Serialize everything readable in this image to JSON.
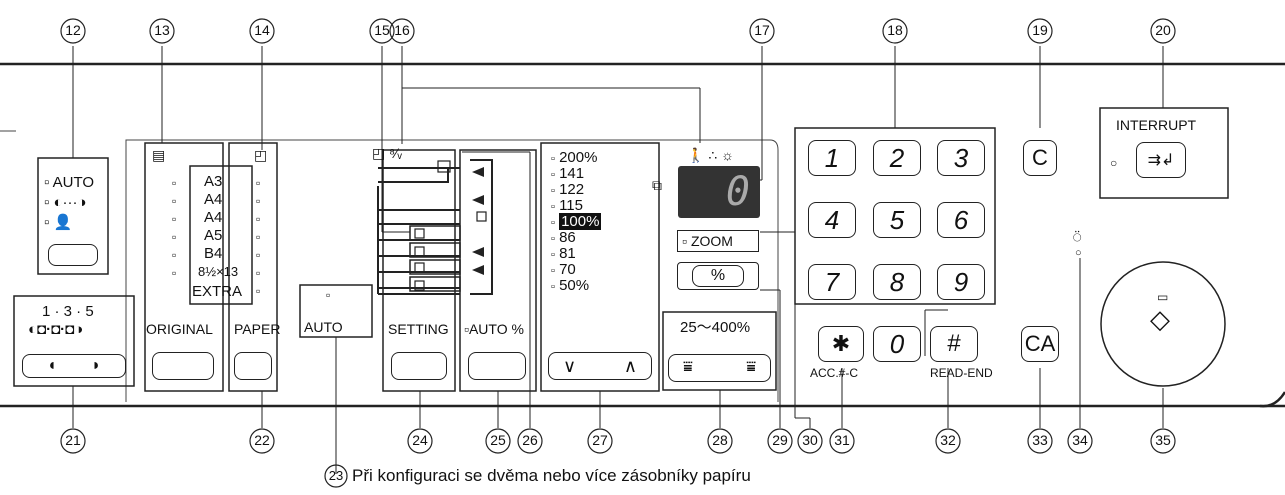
{
  "callouts": [
    "12",
    "13",
    "14",
    "15",
    "16",
    "17",
    "18",
    "19",
    "20",
    "21",
    "22",
    "23",
    "24",
    "25",
    "26",
    "27",
    "28",
    "29",
    "30",
    "31",
    "32",
    "33",
    "34",
    "35"
  ],
  "caption": "Při konfiguraci se dvěma nebo více zásobníky papíru",
  "exposure": {
    "options": [
      "AUTO",
      "◐···◑",
      "👤"
    ]
  },
  "duplex": {
    "top": "1 · 3 · 5",
    "icons": "◐◘·◘·◘◑"
  },
  "original": {
    "button": "ORIGINAL",
    "sizes": [
      "A3",
      "A4",
      "A4",
      "A5",
      "B4",
      "8½×13",
      "EXTRA"
    ]
  },
  "paper": {
    "button": "PAPER"
  },
  "auto_paper": {
    "label": "AUTO"
  },
  "setting": {
    "button": "SETTING"
  },
  "auto_percent": {
    "label": "AUTO %"
  },
  "ratios": [
    "200%",
    "141",
    "122",
    "115",
    "100%",
    "86",
    "81",
    "70",
    "50%"
  ],
  "zoom": {
    "label": "ZOOM",
    "percent_key": "%",
    "range": "25～400%"
  },
  "display": {
    "value": "0"
  },
  "keypad": {
    "keys": [
      "1",
      "2",
      "3",
      "4",
      "5",
      "6",
      "7",
      "8",
      "9",
      "0"
    ],
    "star": "✱",
    "hash": "#",
    "acc_label": "ACC.#-C",
    "read_end": "READ-END"
  },
  "c_key": "C",
  "ca_key": "CA",
  "interrupt": {
    "label": "INTERRUPT",
    "icon": "⇉↲"
  }
}
